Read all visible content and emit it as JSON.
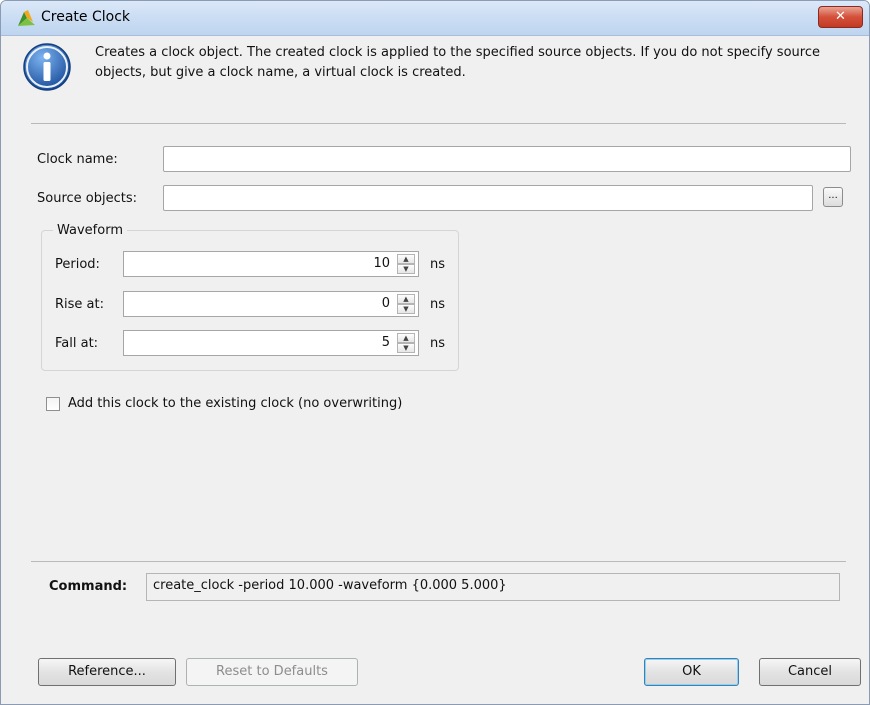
{
  "window": {
    "title": "Create Clock",
    "close_symbol": "✕"
  },
  "info": {
    "text": "Creates a clock object. The created clock is applied to the specified source objects. If you do not specify source objects, but give a clock name, a virtual clock is created."
  },
  "form": {
    "clock_name_label": "Clock name:",
    "clock_name_value": "",
    "source_objects_label": "Source objects:",
    "source_objects_value": "",
    "browse_label": "..."
  },
  "waveform": {
    "title": "Waveform",
    "rows": [
      {
        "label": "Period:",
        "value": "10",
        "unit": "ns"
      },
      {
        "label": "Rise at:",
        "value": "0",
        "unit": "ns"
      },
      {
        "label": "Fall at:",
        "value": "5",
        "unit": "ns"
      }
    ]
  },
  "options": {
    "add_clock_label": "Add this clock to the existing clock (no overwriting)",
    "add_clock_checked": false
  },
  "command": {
    "label": "Command:",
    "value": "create_clock -period 10.000 -waveform {0.000 5.000}"
  },
  "buttons": {
    "reference": "Reference...",
    "reset": "Reset to Defaults",
    "ok": "OK",
    "cancel": "Cancel"
  }
}
